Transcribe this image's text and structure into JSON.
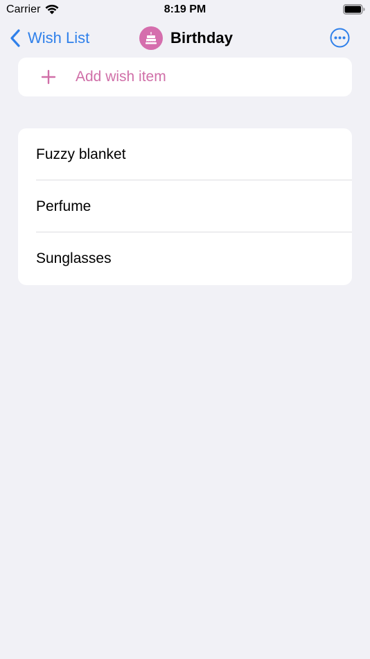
{
  "status_bar": {
    "carrier": "Carrier",
    "time": "8:19 PM"
  },
  "nav": {
    "back_label": "Wish List",
    "title": "Birthday",
    "title_icon": "birthday-cake-icon",
    "more_icon": "ellipsis-circle-icon"
  },
  "add_item": {
    "label": "Add wish item",
    "icon": "plus-icon"
  },
  "items": [
    {
      "label": "Fuzzy blanket"
    },
    {
      "label": "Perfume"
    },
    {
      "label": "Sunglasses"
    }
  ],
  "colors": {
    "accent_blue": "#2f80ea",
    "accent_pink": "#d56ead",
    "background": "#f1f1f6",
    "card": "#ffffff"
  }
}
